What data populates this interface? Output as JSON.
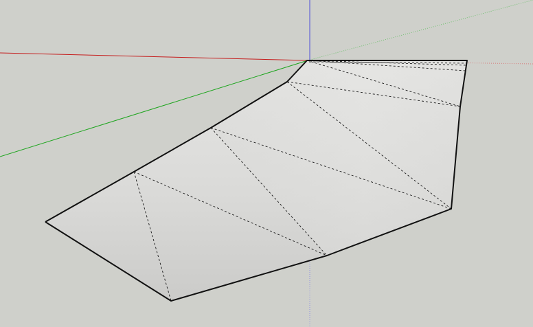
{
  "app": {
    "type": "3d-modeling-viewport"
  },
  "viewport": {
    "background_color": "#cfd0cb",
    "axes": {
      "red_axis_color": "#c51c1c",
      "green_axis_color": "#1ea51e",
      "blue_axis_color": "#4f4fd8"
    },
    "surface": {
      "fill_top": "#e3e3e1",
      "fill_bottom": "#cfcfcd",
      "edge_color": "#111111",
      "hidden_edge_style": "dashed"
    }
  }
}
